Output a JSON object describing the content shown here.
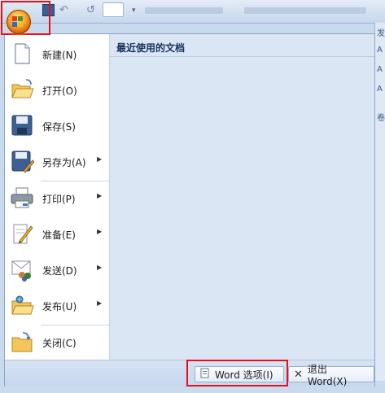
{
  "menu": {
    "items": [
      {
        "label": "新建(N)",
        "icon": "new-document-icon",
        "submenu": false
      },
      {
        "label": "打开(O)",
        "icon": "open-folder-icon",
        "submenu": false
      },
      {
        "label": "保存(S)",
        "icon": "save-disk-icon",
        "submenu": false
      },
      {
        "label": "另存为(A)",
        "icon": "save-as-icon",
        "submenu": true
      },
      {
        "label": "打印(P)",
        "icon": "printer-icon",
        "submenu": true
      },
      {
        "label": "准备(E)",
        "icon": "prepare-icon",
        "submenu": true
      },
      {
        "label": "发送(D)",
        "icon": "send-icon",
        "submenu": true
      },
      {
        "label": "发布(U)",
        "icon": "publish-icon",
        "submenu": true
      },
      {
        "label": "关闭(C)",
        "icon": "close-folder-icon",
        "submenu": false
      }
    ],
    "recent_title": "最近使用的文档"
  },
  "footer": {
    "options_label": "Word 选项(I)",
    "exit_label": "退出 Word(X)"
  },
  "right_strip": {
    "chars": [
      "发",
      "A",
      "A",
      "A",
      "卷"
    ]
  },
  "colors": {
    "highlight": "#e8101a",
    "accent": "#dbe6f4"
  }
}
